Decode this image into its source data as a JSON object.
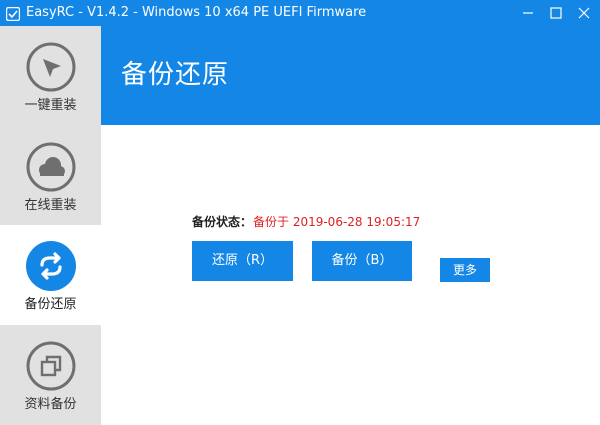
{
  "window": {
    "title": "EasyRC - V1.4.2 - Windows 10 x64 PE UEFI Firmware",
    "icon": "easyrc-app-icon",
    "controls": [
      "minimize-icon",
      "maximize-icon",
      "close-icon"
    ]
  },
  "sidebar": {
    "items": [
      {
        "label": "一键重装",
        "icon": "cursor-arrow-icon",
        "active": false
      },
      {
        "label": "在线重装",
        "icon": "cloud-icon",
        "active": false
      },
      {
        "label": "备份还原",
        "icon": "sync-arrows-icon",
        "active": true
      },
      {
        "label": "资料备份",
        "icon": "copy-icon",
        "active": false
      }
    ]
  },
  "main": {
    "title": "备份还原",
    "status_label": "备份状态：",
    "status_value": "备份于 2019-06-28 19:05:17",
    "restore_button": "还原（R）",
    "backup_button": "备份（B）",
    "more_button": "更多"
  },
  "colors": {
    "accent": "#1487e6",
    "sidebar_bg": "#e1e1e1",
    "status_red": "#e02020"
  }
}
